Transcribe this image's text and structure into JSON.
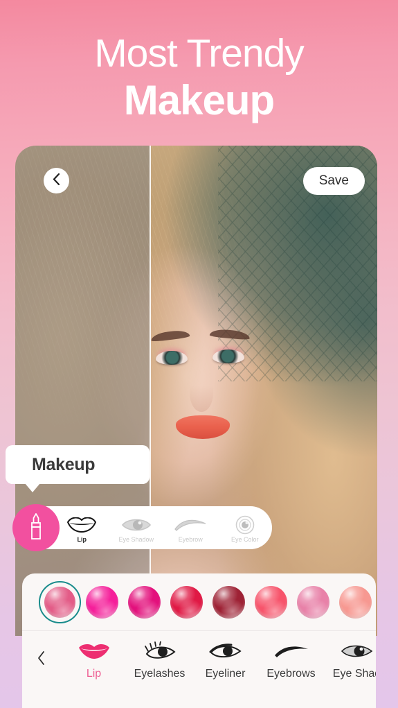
{
  "headline": {
    "line1": "Most Trendy",
    "line2": "Makeup"
  },
  "photo_editor": {
    "back_button": "chevron-left-icon",
    "save_label": "Save",
    "split_view": "before-after"
  },
  "callout": {
    "label": "Makeup"
  },
  "tool_pill": {
    "lipstick_badge": "lipstick-icon",
    "items": [
      {
        "label": "Lip",
        "icon": "lips-icon",
        "active": true
      },
      {
        "label": "Eye Shadow",
        "icon": "eye-shadow-icon",
        "active": false
      },
      {
        "label": "Eyebrow",
        "icon": "eyebrow-icon",
        "active": false
      },
      {
        "label": "Eye Color",
        "icon": "eye-color-icon",
        "active": false
      }
    ]
  },
  "swatches": {
    "selected_index": 0,
    "selection_ring_color": "#1A8C8C",
    "colors": [
      {
        "name": "rose-pink",
        "hex": "#E35C87"
      },
      {
        "name": "hot-magenta",
        "hex": "#F51F9A"
      },
      {
        "name": "deep-magenta",
        "hex": "#E3107C"
      },
      {
        "name": "crimson-red",
        "hex": "#E01945"
      },
      {
        "name": "wine-red",
        "hex": "#9E2235"
      },
      {
        "name": "coral-pink",
        "hex": "#F7546B"
      },
      {
        "name": "medium-pink",
        "hex": "#E881A8"
      },
      {
        "name": "peach-pink",
        "hex": "#F79891"
      }
    ]
  },
  "bottom_nav": {
    "back_icon": "chevron-left-icon",
    "active_color": "#EE5E92",
    "items": [
      {
        "label": "Lip",
        "icon": "lips-icon",
        "active": true
      },
      {
        "label": "Eyelashes",
        "icon": "eyelashes-icon",
        "active": false
      },
      {
        "label": "Eyeliner",
        "icon": "eyeliner-icon",
        "active": false
      },
      {
        "label": "Eyebrows",
        "icon": "eyebrow-icon",
        "active": false
      },
      {
        "label": "Eye Shad",
        "icon": "eye-shadow-icon",
        "active": false
      }
    ]
  }
}
